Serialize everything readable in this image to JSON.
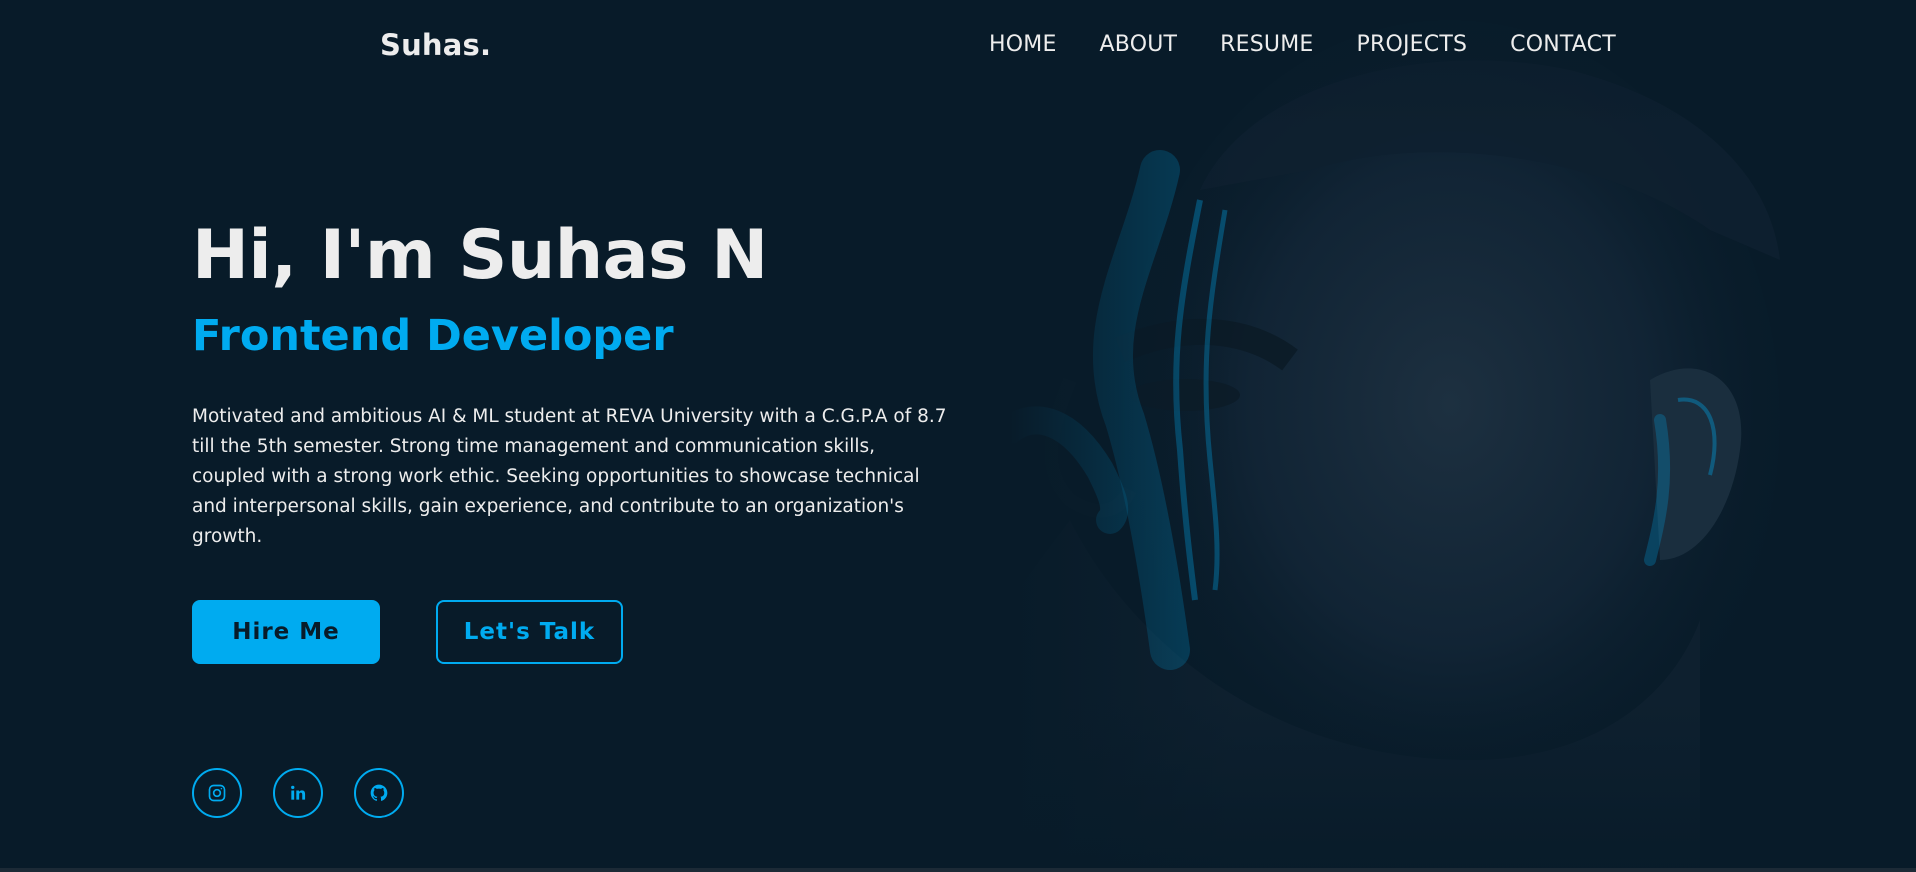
{
  "header": {
    "logo": "Suhas.",
    "nav": [
      "HOME",
      "ABOUT",
      "RESUME",
      "PROJECTS",
      "CONTACT"
    ]
  },
  "hero": {
    "title": "Hi, I'm Suhas N",
    "subtitle": "Frontend Developer",
    "description": "Motivated and ambitious AI & ML student at REVA University with a C.G.P.A of 8.7 till the 5th semester. Strong time management and communication skills, coupled with a strong work ethic. Seeking opportunities to showcase technical and interpersonal skills, gain experience, and contribute to an organization's growth.",
    "buttons": {
      "primary": "Hire Me",
      "secondary": "Let's Talk"
    }
  },
  "social": [
    "instagram-icon",
    "linkedin-icon",
    "github-icon"
  ],
  "colors": {
    "background": "#081b29",
    "accent": "#00abf0",
    "text": "#ededed"
  }
}
